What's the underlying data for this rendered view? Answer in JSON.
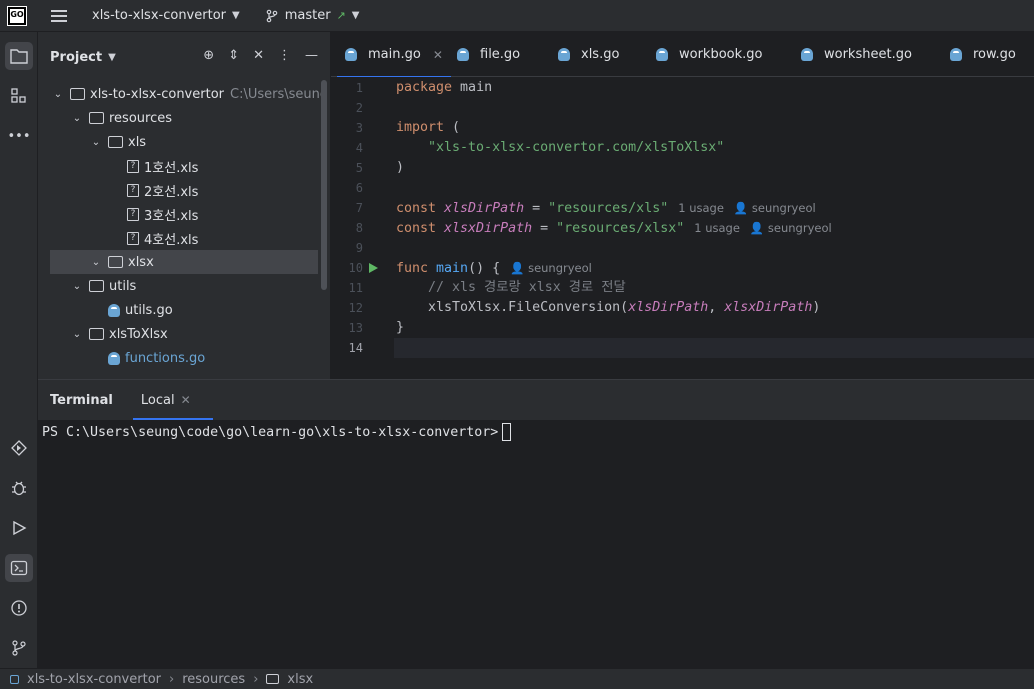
{
  "titlebar": {
    "logo": "GO",
    "project_name": "xls-to-xlsx-convertor",
    "branch": "master"
  },
  "project_panel": {
    "title": "Project",
    "tree": [
      {
        "label": "xls-to-xlsx-convertor",
        "hint": "C:\\Users\\seung",
        "type": "folder",
        "depth": 0,
        "expanded": true
      },
      {
        "label": "resources",
        "type": "folder",
        "depth": 1,
        "expanded": true
      },
      {
        "label": "xls",
        "type": "folder",
        "depth": 2,
        "expanded": true
      },
      {
        "label": "1호선.xls",
        "type": "unknown",
        "depth": 3
      },
      {
        "label": "2호선.xls",
        "type": "unknown",
        "depth": 3
      },
      {
        "label": "3호선.xls",
        "type": "unknown",
        "depth": 3
      },
      {
        "label": "4호선.xls",
        "type": "unknown",
        "depth": 3
      },
      {
        "label": "xlsx",
        "type": "folder",
        "depth": 2,
        "expanded": true,
        "selected": true
      },
      {
        "label": "utils",
        "type": "folder",
        "depth": 1,
        "expanded": true
      },
      {
        "label": "utils.go",
        "type": "go",
        "depth": 2
      },
      {
        "label": "xlsToXlsx",
        "type": "folder",
        "depth": 1,
        "expanded": true
      },
      {
        "label": "functions.go",
        "type": "go",
        "depth": 2,
        "modified": true
      }
    ]
  },
  "editor": {
    "tabs": [
      {
        "label": "main.go",
        "active": true
      },
      {
        "label": "file.go"
      },
      {
        "label": "xls.go"
      },
      {
        "label": "workbook.go"
      },
      {
        "label": "worksheet.go"
      },
      {
        "label": "row.go"
      }
    ],
    "line_numbers": [
      "1",
      "2",
      "3",
      "4",
      "5",
      "6",
      "7",
      "8",
      "9",
      "10",
      "11",
      "12",
      "13",
      "14"
    ],
    "current_line": "14",
    "code": {
      "l1_kw": "package",
      "l1_rest": " main",
      "l3_kw": "import",
      "l3_rest": " (",
      "l4_str": "    \"xls-to-xlsx-convertor.com/xlsToXlsx\"",
      "l5": ")",
      "l7_kw": "const",
      "l7_var": " xlsDirPath",
      "l7_eq": " = ",
      "l7_str": "\"resources/xls\"",
      "l8_kw": "const",
      "l8_var": " xlsxDirPath",
      "l8_eq": " = ",
      "l8_str": "\"resources/xlsx\"",
      "l10_kw": "func",
      "l10_fn": " main",
      "l10_rest": "() {",
      "l11_cmt": "    // xls 경로랑 xlsx 경로 전달",
      "l12_pkg": "    xlsToXlsx",
      "l12_dot": ".",
      "l12_method": "FileConversion",
      "l12_open": "(",
      "l12_a1": "xlsDirPath",
      "l12_comma": ", ",
      "l12_a2": "xlsxDirPath",
      "l12_close": ")",
      "l13": "}"
    },
    "hints": {
      "usage": "1 usage",
      "author": "seungryeol"
    }
  },
  "terminal": {
    "title": "Terminal",
    "tab": "Local",
    "prompt": "PS C:\\Users\\seung\\code\\go\\learn-go\\xls-to-xlsx-convertor>"
  },
  "statusbar": {
    "crumbs": [
      "xls-to-xlsx-convertor",
      "resources",
      "xlsx"
    ]
  }
}
